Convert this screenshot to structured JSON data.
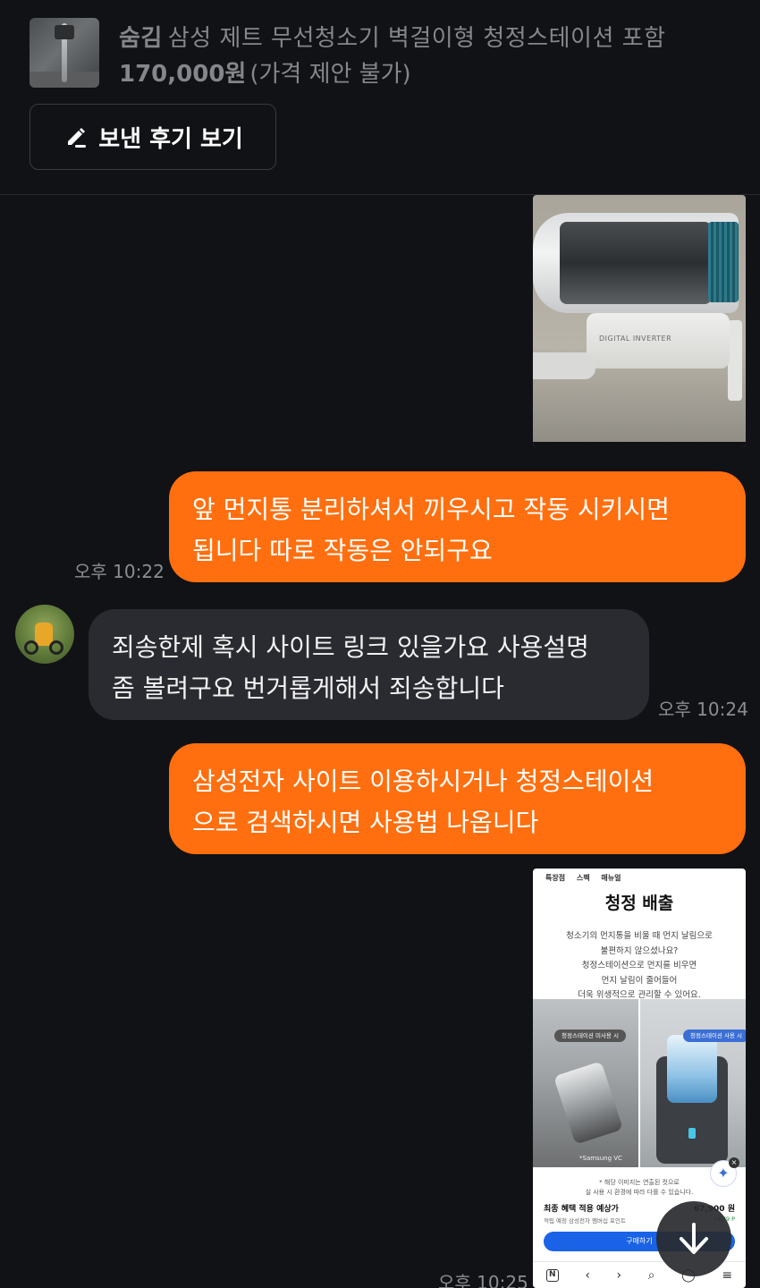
{
  "product": {
    "status": "숨김",
    "title": "삼성 제트 무선청소기 벽걸이형 청정스테이션 포함",
    "price": "170,000원",
    "price_note": "(가격 제안 불가)",
    "thumbnail_icon": "vacuum-photo"
  },
  "review_button": {
    "label": "보낸 후기 보기",
    "icon": "pencil-icon"
  },
  "messages": [
    {
      "kind": "image",
      "from": "me",
      "image_desc": "vacuum-photo",
      "image_text": "DIGITAL INVERTER"
    },
    {
      "kind": "text",
      "from": "me",
      "text": "앞 먼지통 분리하셔서 끼우시고 작동 시키시면\n됩니다 따로 작동은 안되구요",
      "time": "오후 10:22"
    },
    {
      "kind": "text",
      "from": "other",
      "text": "죄송한제 혹시 사이트 링크 있을가요 사용설명\n좀 볼려구요 번거롭게해서 죄송합니다",
      "time": "오후 10:24"
    },
    {
      "kind": "text",
      "from": "me",
      "text": "삼성전자 사이트 이용하시거나 청정스테이션\n으로 검색하시면 사용법 나옵니다"
    },
    {
      "kind": "image",
      "from": "me",
      "time": "오후 10:25",
      "web": {
        "topnav": "특장점 스펙 매뉴얼",
        "title": "청정 배출",
        "desc": "청소기의 먼지통을 비울 때 먼지 날림으로\n불편하지 않으셨나요?\n청정스테이션으로 먼지를 비우면\n먼지 날림이 줄어들어\n더욱 위생적으로 관리할 수 있어요.",
        "pill_left": "청정스테이션 미사용 시",
        "pill_right": "청정스테이션 사용 시",
        "brand_mark": "*Samsung VC",
        "note": "* 해당 이미지는 연출된 컷으로\n실 사용 시 환경에 따라 다를 수 있습니다.",
        "price_label": "최종 혜택 적용 예상가",
        "price_value": "67,900 원",
        "sub_label": "적립 예정 삼성전자 멤버십 포인트",
        "sub_value": "+679 P",
        "buy_label": "구매하기",
        "bottom_icons": [
          "N",
          "‹",
          "›",
          "⌕",
          "◯",
          "≡"
        ]
      }
    }
  ],
  "scroll_button": {
    "icon": "arrow-down-icon"
  },
  "colors": {
    "background": "#111216",
    "my_bubble": "#ff6f0f",
    "their_bubble": "#2a2b30",
    "timestamp": "#8c8d92"
  }
}
